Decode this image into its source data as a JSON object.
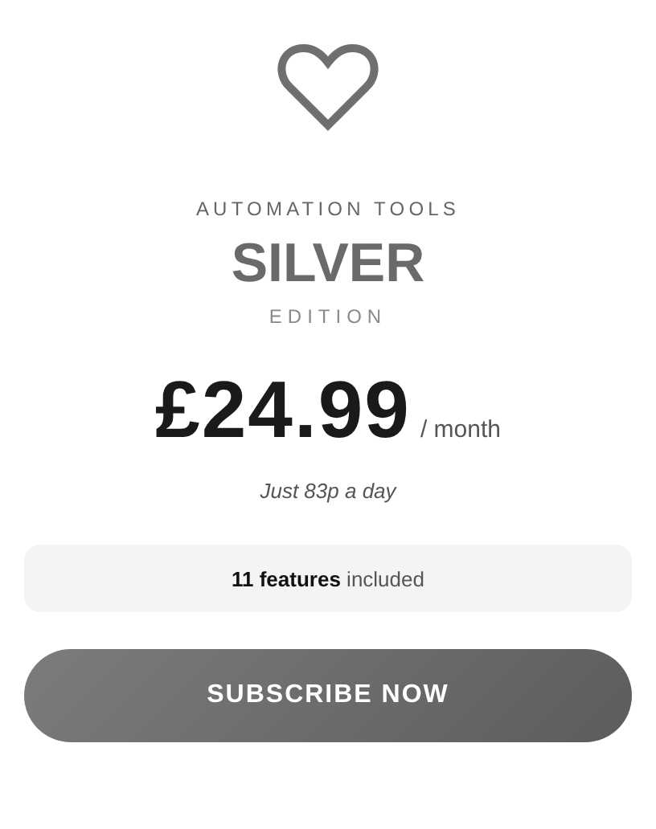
{
  "category": "AUTOMATION TOOLS",
  "plan": "SILVER",
  "edition": "EDITION",
  "price": "£24.99",
  "period": "/ month",
  "daily_note": "Just 83p a day",
  "features": "**11 features** included",
  "button": "SUBSCRIBE NOW"
}
